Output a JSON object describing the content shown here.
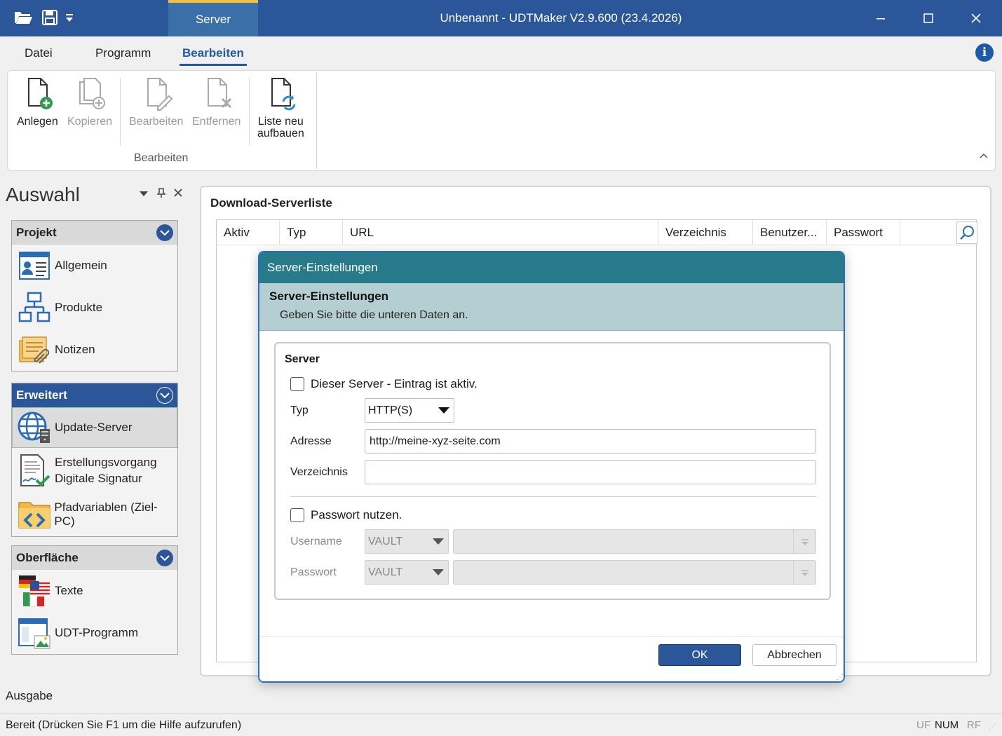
{
  "titlebar": {
    "context_tab": "Server",
    "window_title": "Unbenannt - UDTMaker V2.9.600 (23.4.2026)",
    "icons": [
      "open-folder-icon",
      "save-icon",
      "quick-access-dropdown-icon",
      "minimize-icon",
      "maximize-icon",
      "close-icon"
    ]
  },
  "ribbon_tabs": [
    "Datei",
    "Programm",
    "Bearbeiten"
  ],
  "active_tab": "Bearbeiten",
  "ribbon": {
    "buttons": {
      "anlegen": "Anlegen",
      "kopieren": "Kopieren",
      "bearbeiten": "Bearbeiten",
      "entfernen": "Entfernen",
      "liste_neu_1": "Liste neu",
      "liste_neu_2": "aufbauen"
    },
    "group_label": "Bearbeiten"
  },
  "leftpane": {
    "title": "Auswahl",
    "groups": {
      "projekt": {
        "header": "Projekt",
        "items": [
          "Allgemein",
          "Produkte",
          "Notizen"
        ]
      },
      "erweitert": {
        "header": "Erweitert",
        "items": [
          "Update-Server",
          "Erstellungsvorgang",
          "Digitale Signatur",
          "Pfadvariablen (Ziel-PC)"
        ]
      },
      "oberflaeche": {
        "header": "Oberfläche",
        "items": [
          "Texte",
          "UDT-Programm"
        ]
      }
    }
  },
  "main": {
    "title": "Download-Serverliste",
    "columns": [
      "Aktiv",
      "Typ",
      "URL",
      "Verzeichnis",
      "Benutzer...",
      "Passwort"
    ]
  },
  "dialog": {
    "title": "Server-Einstellungen",
    "banner_title": "Server-Einstellungen",
    "banner_subtitle": "Geben Sie bitte die unteren Daten an.",
    "group_label": "Server",
    "active_checkbox_label": "Dieser Server - Eintrag ist aktiv.",
    "typ_label": "Typ",
    "typ_value": "HTTP(S)",
    "adresse_label": "Adresse",
    "adresse_value": "http://meine-xyz-seite.com",
    "verzeichnis_label": "Verzeichnis",
    "verzeichnis_value": "",
    "password_checkbox_label": "Passwort nutzen.",
    "username_label": "Username",
    "username_source": "VAULT",
    "passwort_label": "Passwort",
    "passwort_source": "VAULT",
    "ok_label": "OK",
    "cancel_label": "Abbrechen"
  },
  "bottom": {
    "ausgabe": "Ausgabe",
    "status": "Bereit (Drücken Sie F1 um die Hilfe aufzurufen)",
    "indicators": {
      "uf": "UF",
      "num": "NUM",
      "rf": "RF"
    }
  },
  "colors": {
    "titlebar": "#2b579a",
    "dialog_title": "#267a8a",
    "dialog_banner": "#b5ced2",
    "accent": "#1e5aa8"
  }
}
